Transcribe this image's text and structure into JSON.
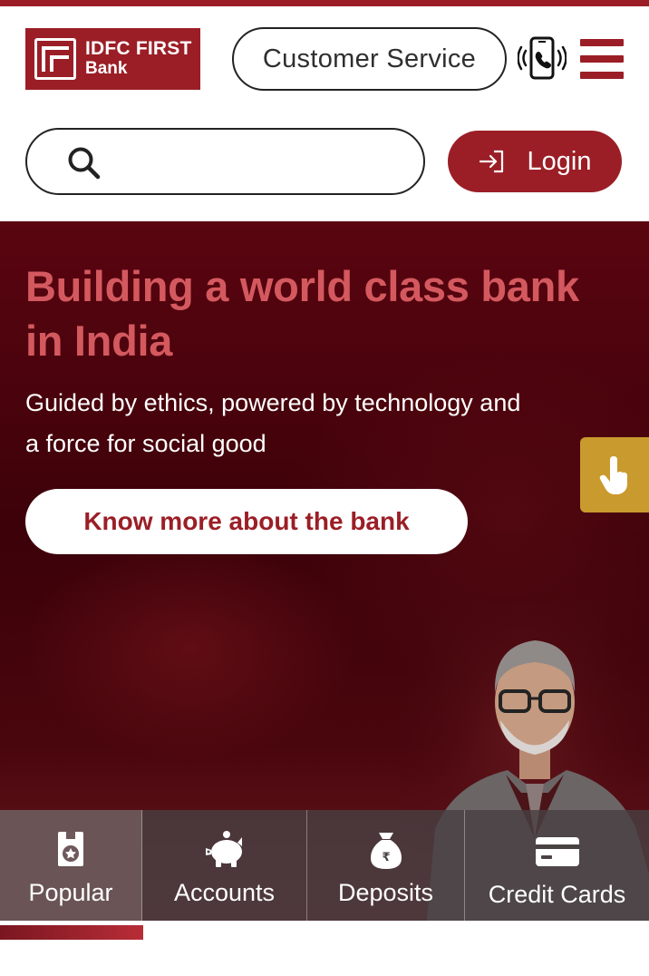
{
  "header": {
    "logo_line1": "IDFC FIRST",
    "logo_line2": "Bank",
    "customer_service_label": "Customer Service",
    "login_label": "Login",
    "search_placeholder": ""
  },
  "hero": {
    "title": "Building a world class bank in India",
    "subtitle": "Guided by ethics, powered by technology and a force for social good",
    "cta_label": "Know more about the bank"
  },
  "tabs": [
    {
      "label": "Popular",
      "icon": "badge-star-icon",
      "active": true
    },
    {
      "label": "Accounts",
      "icon": "piggy-bank-icon",
      "active": false
    },
    {
      "label": "Deposits",
      "icon": "money-bag-rupee-icon",
      "active": false
    },
    {
      "label": "Credit Cards",
      "icon": "credit-card-icon",
      "active": false
    }
  ],
  "colors": {
    "brand": "#9b1e26",
    "hero_title": "#d4595f",
    "touch_tab": "#c99a2e"
  }
}
